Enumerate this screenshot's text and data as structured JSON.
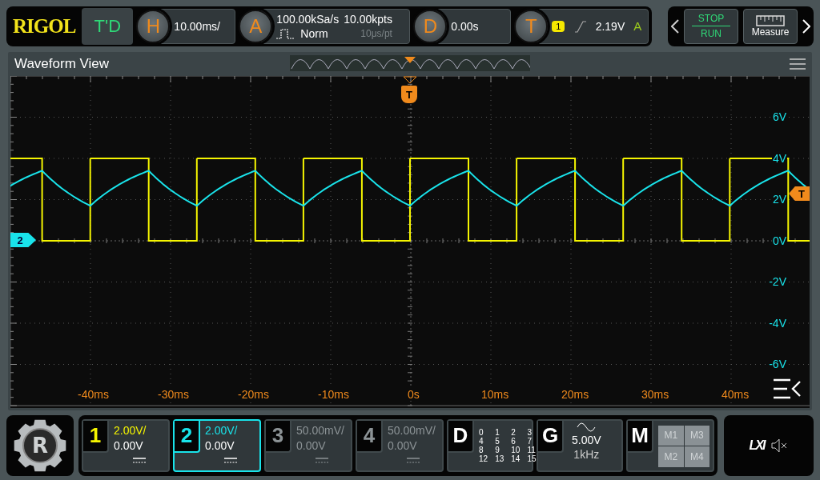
{
  "top_bar": {
    "logo": "RIGOL",
    "mode": "T'D",
    "horizontal": {
      "badge": "H",
      "value": "10.00ms/"
    },
    "acquisition": {
      "badge": "A",
      "sample_rate": "100.00kSa/s",
      "memory": "10.00kpts",
      "mode": "Norm",
      "resolution": "10μs/pt"
    },
    "delay": {
      "badge": "D",
      "value": "0.00s"
    },
    "trigger": {
      "badge": "T",
      "source": "1",
      "level": "2.19V",
      "sweep": "A"
    },
    "run_control": {
      "top": "STOP",
      "bottom": "RUN"
    },
    "measure": "Measure"
  },
  "waveform_view": {
    "title": "Waveform View",
    "trigger_marker": "T",
    "trigger_level_marker": "T",
    "channel_marker": "2",
    "y_labels": [
      "6V",
      "4V",
      "2V",
      "0V",
      "-2V",
      "-4V",
      "-6V"
    ],
    "x_labels": [
      "-40ms",
      "-30ms",
      "-20ms",
      "-10ms",
      "0s",
      "10ms",
      "20ms",
      "30ms",
      "40ms"
    ]
  },
  "menu_logo": "R",
  "channels": [
    {
      "number": "1",
      "scale": "2.00V/",
      "offset": "0.00V",
      "selected": false,
      "enabled": true,
      "color": "#f5f500"
    },
    {
      "number": "2",
      "scale": "2.00V/",
      "offset": "0.00V",
      "selected": true,
      "enabled": true,
      "color": "#19e3ea"
    },
    {
      "number": "3",
      "scale": "50.00mV/",
      "offset": "0.00V",
      "selected": false,
      "enabled": false
    },
    {
      "number": "4",
      "scale": "50.00mV/",
      "offset": "0.00V",
      "selected": false,
      "enabled": false
    }
  ],
  "digital": {
    "label": "D",
    "channels": [
      "0",
      "1",
      "2",
      "3",
      "4",
      "5",
      "6",
      "7",
      "8",
      "9",
      "10",
      "11",
      "12",
      "13",
      "14",
      "15"
    ]
  },
  "generator": {
    "label": "G",
    "amplitude": "5.00V",
    "frequency": "1kHz"
  },
  "math": {
    "label": "M",
    "items": [
      "M1",
      "M3",
      "M2",
      "M4"
    ]
  },
  "status": {
    "lxi": "LXI"
  }
}
